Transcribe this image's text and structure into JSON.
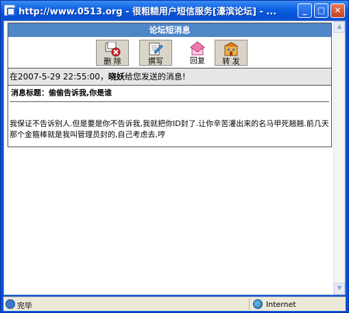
{
  "window": {
    "title": "http://www.0513.org - 很粗糙用户短信服务[濠滨论坛] - ...",
    "controls": {
      "minimize": "_",
      "maximize": "□",
      "close": "✕"
    }
  },
  "panel": {
    "header": "论坛短消息",
    "toolbar": [
      {
        "label": "删 除",
        "icon": "delete-icon"
      },
      {
        "label": "撰写",
        "icon": "compose-icon"
      },
      {
        "label": "回复",
        "icon": "reply-icon"
      },
      {
        "label": "转 发",
        "icon": "forward-icon"
      }
    ],
    "info": {
      "prefix": "在2007-5-29 22:55:00，",
      "sender": "晓妖",
      "suffix": "给您发送的消息!"
    },
    "subject_label": "消息标题：",
    "subject": "偷偷告诉我,你是谁",
    "body": "我保证不告诉别人.但是要是你不告诉我,我就把你ID封了.让你辛苦灌出来的名马甲死翘翘.前几天那个金箍棒就是我叫管理员封的,自己考虑去,哼"
  },
  "statusbar": {
    "status": "完毕",
    "zone": "Internet"
  },
  "colors": {
    "title_blue": "#0a4fd6",
    "panel_header": "#4f86c6",
    "info_bg": "#e6e6e6"
  }
}
